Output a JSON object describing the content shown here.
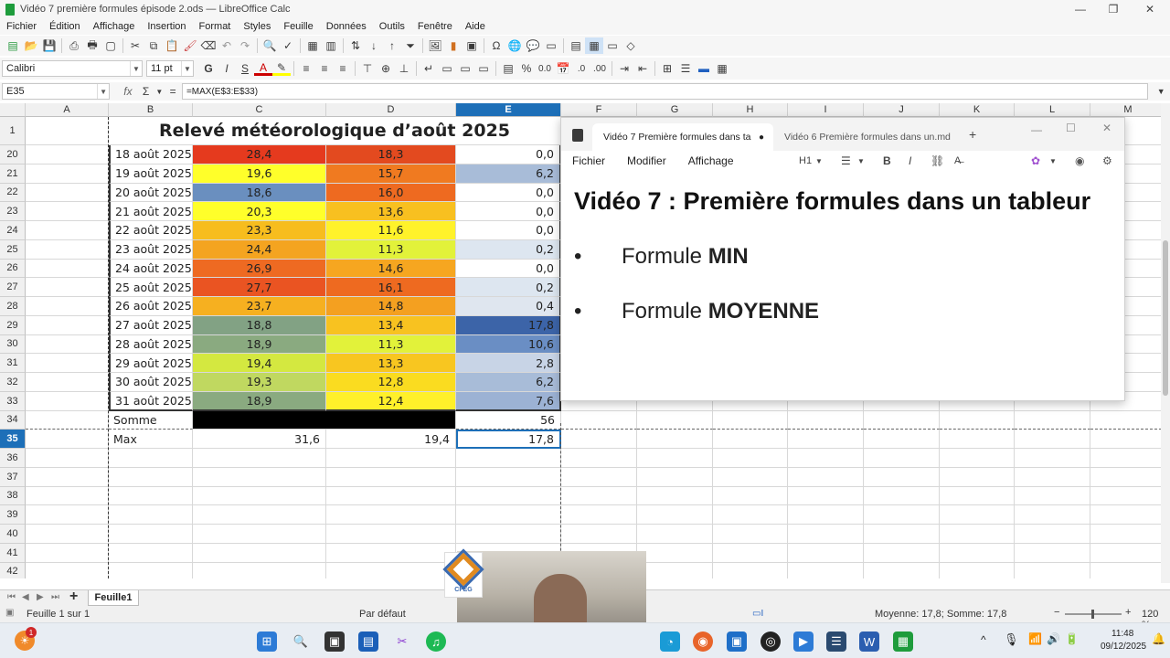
{
  "window": {
    "title": "Vidéo 7 première formules épisode 2.ods — LibreOffice Calc"
  },
  "menu": [
    "Fichier",
    "Édition",
    "Affichage",
    "Insertion",
    "Format",
    "Styles",
    "Feuille",
    "Données",
    "Outils",
    "Fenêtre",
    "Aide"
  ],
  "format_bar": {
    "font_name": "Calibri",
    "font_size": "11 pt",
    "bold": "G",
    "italic": "I",
    "underline": "S",
    "font_color_letter": "A",
    "percent": "%",
    "decimals": "0.0"
  },
  "formula_bar": {
    "name_box": "E35",
    "fx": "fx",
    "sigma": "Σ",
    "equals": "=",
    "formula": "=MAX(E$3:E$33)"
  },
  "columns": [
    "A",
    "B",
    "C",
    "D",
    "E",
    "F",
    "G",
    "H",
    "I",
    "J",
    "K",
    "L",
    "M"
  ],
  "selected_column": "E",
  "sheet_title": "Relevé météorologique d’août 2025",
  "rows": [
    {
      "num": "20",
      "date": "18 août 2025",
      "c": "28,4",
      "d": "18,3",
      "e": "0,0",
      "cc": "#e53a1e",
      "dc": "#e34a1f",
      "ec": "#ffffff"
    },
    {
      "num": "21",
      "date": "19 août 2025",
      "c": "19,6",
      "d": "15,7",
      "e": "6,2",
      "cc": "#ffff2a",
      "dc": "#f07a20",
      "ec": "#a8bcd8"
    },
    {
      "num": "22",
      "date": "20 août 2025",
      "c": "18,6",
      "d": "16,0",
      "e": "0,0",
      "cc": "#6a8fbf",
      "dc": "#ee6a20",
      "ec": "#ffffff"
    },
    {
      "num": "23",
      "date": "21 août 2025",
      "c": "20,3",
      "d": "13,6",
      "e": "0,0",
      "cc": "#ffff2a",
      "dc": "#f8c020",
      "ec": "#ffffff"
    },
    {
      "num": "24",
      "date": "22 août 2025",
      "c": "23,3",
      "d": "11,6",
      "e": "0,0",
      "cc": "#f7bd1e",
      "dc": "#fff22a",
      "ec": "#ffffff"
    },
    {
      "num": "25",
      "date": "23 août 2025",
      "c": "24,4",
      "d": "11,3",
      "e": "0,2",
      "cc": "#f4a420",
      "dc": "#e2f23a",
      "ec": "#dde6f0"
    },
    {
      "num": "26",
      "date": "24 août 2025",
      "c": "26,9",
      "d": "14,6",
      "e": "0,0",
      "cc": "#ee6a22",
      "dc": "#f6a620",
      "ec": "#ffffff"
    },
    {
      "num": "27",
      "date": "25 août 2025",
      "c": "27,7",
      "d": "16,1",
      "e": "0,2",
      "cc": "#ea5422",
      "dc": "#ee6a20",
      "ec": "#dde6f0"
    },
    {
      "num": "28",
      "date": "26 août 2025",
      "c": "23,7",
      "d": "14,8",
      "e": "0,4",
      "cc": "#f6b020",
      "dc": "#f4a020",
      "ec": "#dfe6ef"
    },
    {
      "num": "29",
      "date": "27 août 2025",
      "c": "18,8",
      "d": "13,4",
      "e": "17,8",
      "cc": "#82a284",
      "dc": "#f8c220",
      "ec": "#3c64a8"
    },
    {
      "num": "30",
      "date": "28 août 2025",
      "c": "18,9",
      "d": "11,3",
      "e": "10,6",
      "cc": "#8aaa80",
      "dc": "#e2f23a",
      "ec": "#6a8ec4"
    },
    {
      "num": "31",
      "date": "29 août 2025",
      "c": "19,4",
      "d": "13,3",
      "e": "2,8",
      "cc": "#d4e840",
      "dc": "#f8c620",
      "ec": "#c8d4e6"
    },
    {
      "num": "32",
      "date": "30 août 2025",
      "c": "19,3",
      "d": "12,8",
      "e": "6,2",
      "cc": "#c0d860",
      "dc": "#fadc20",
      "ec": "#a8bcd8"
    },
    {
      "num": "33",
      "date": "31 août 2025",
      "c": "18,9",
      "d": "12,4",
      "e": "7,6",
      "cc": "#8aaa80",
      "dc": "#fff02a",
      "ec": "#9cb2d4"
    }
  ],
  "sum_row": {
    "num": "34",
    "label": "Somme",
    "e": "56"
  },
  "max_row": {
    "num": "35",
    "label": "Max",
    "c": "31,6",
    "d": "19,4",
    "e": "17,8"
  },
  "empty_rows": [
    "36",
    "37",
    "38",
    "39",
    "40",
    "41",
    "42"
  ],
  "notepad": {
    "tab_active": "Vidéo 7  Première formules dans ta",
    "tab_other": "Vidéo 6  Première formules dans un.md",
    "menu": [
      "Fichier",
      "Modifier",
      "Affichage"
    ],
    "heading_level": "H1",
    "heading": "Vidéo 7 : Première formules dans un tableur",
    "bullets": [
      {
        "prefix": "Formule ",
        "bold": "MIN"
      },
      {
        "prefix": "Formule ",
        "bold": "MOYENNE"
      }
    ]
  },
  "sheet_tabs": {
    "active": "Feuille1"
  },
  "status": {
    "sheet": "Feuille 1 sur 1",
    "style": "Par défaut",
    "summary": "Moyenne: 17,8; Somme: 17,8",
    "zoom": "120 %"
  },
  "webcam": {
    "logo_text": "CFEG"
  },
  "taskbar": {
    "time": "11:48",
    "date": "09/12/2025",
    "badge": "1"
  },
  "colors": {
    "selection_blue": "#1d6fb8",
    "header_gray": "#f0f0f0"
  }
}
